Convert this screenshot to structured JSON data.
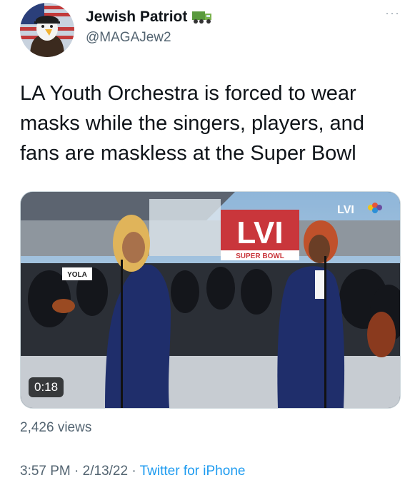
{
  "author": {
    "display_name": "Jewish Patriot",
    "handle": "@MAGAJew2",
    "avatar_icon": "bald-eagle-flag-icon",
    "name_emoji_icon": "truck-icon"
  },
  "more_options_label": "···",
  "tweet": {
    "text": "LA Youth Orchestra is forced to wear\nmasks while the singers, players, and\nfans are maskless at the Super Bowl"
  },
  "video": {
    "duration": "0:18",
    "overlay_logo": "LVI",
    "stage_sign": "SUPER BOWL",
    "stage_letters": "LVI",
    "music_stand_text": "YOLA"
  },
  "stats": {
    "views": "2,426 views"
  },
  "meta": {
    "time": "3:57 PM",
    "separator": " · ",
    "date": "2/13/22",
    "source": "Twitter for iPhone"
  },
  "colors": {
    "text": "#0f1419",
    "secondary": "#536471",
    "link": "#1d9bf0"
  }
}
